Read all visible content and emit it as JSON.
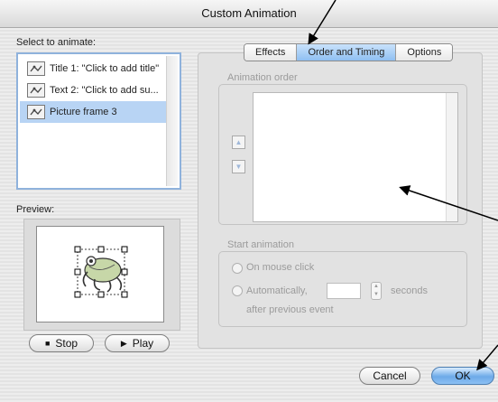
{
  "window": {
    "title": "Custom Animation"
  },
  "left": {
    "select_label": "Select to animate:",
    "items": [
      {
        "label": "Title 1: \"Click to add title\"",
        "icon": "animation-effect-icon"
      },
      {
        "label": "Text 2: \"Click to add su...",
        "icon": "animation-effect-icon"
      },
      {
        "label": "Picture frame 3",
        "icon": "animation-effect-icon",
        "selected": true
      }
    ],
    "preview_label": "Preview:",
    "stop_label": "Stop",
    "play_label": "Play"
  },
  "tabs": [
    {
      "label": "Effects"
    },
    {
      "label": "Order and Timing",
      "active": true
    },
    {
      "label": "Options"
    }
  ],
  "order": {
    "title": "Animation order"
  },
  "start": {
    "title": "Start animation",
    "on_click_label": "On mouse click",
    "auto_label": "Automatically,",
    "seconds_label": "seconds",
    "after_label": "after previous event",
    "seconds_value": ""
  },
  "buttons": {
    "cancel": "Cancel",
    "ok": "OK"
  },
  "colors": {
    "selection": "#b8d4f4",
    "ok_button": "#6daae8",
    "annotation_arrow": "#000000"
  }
}
